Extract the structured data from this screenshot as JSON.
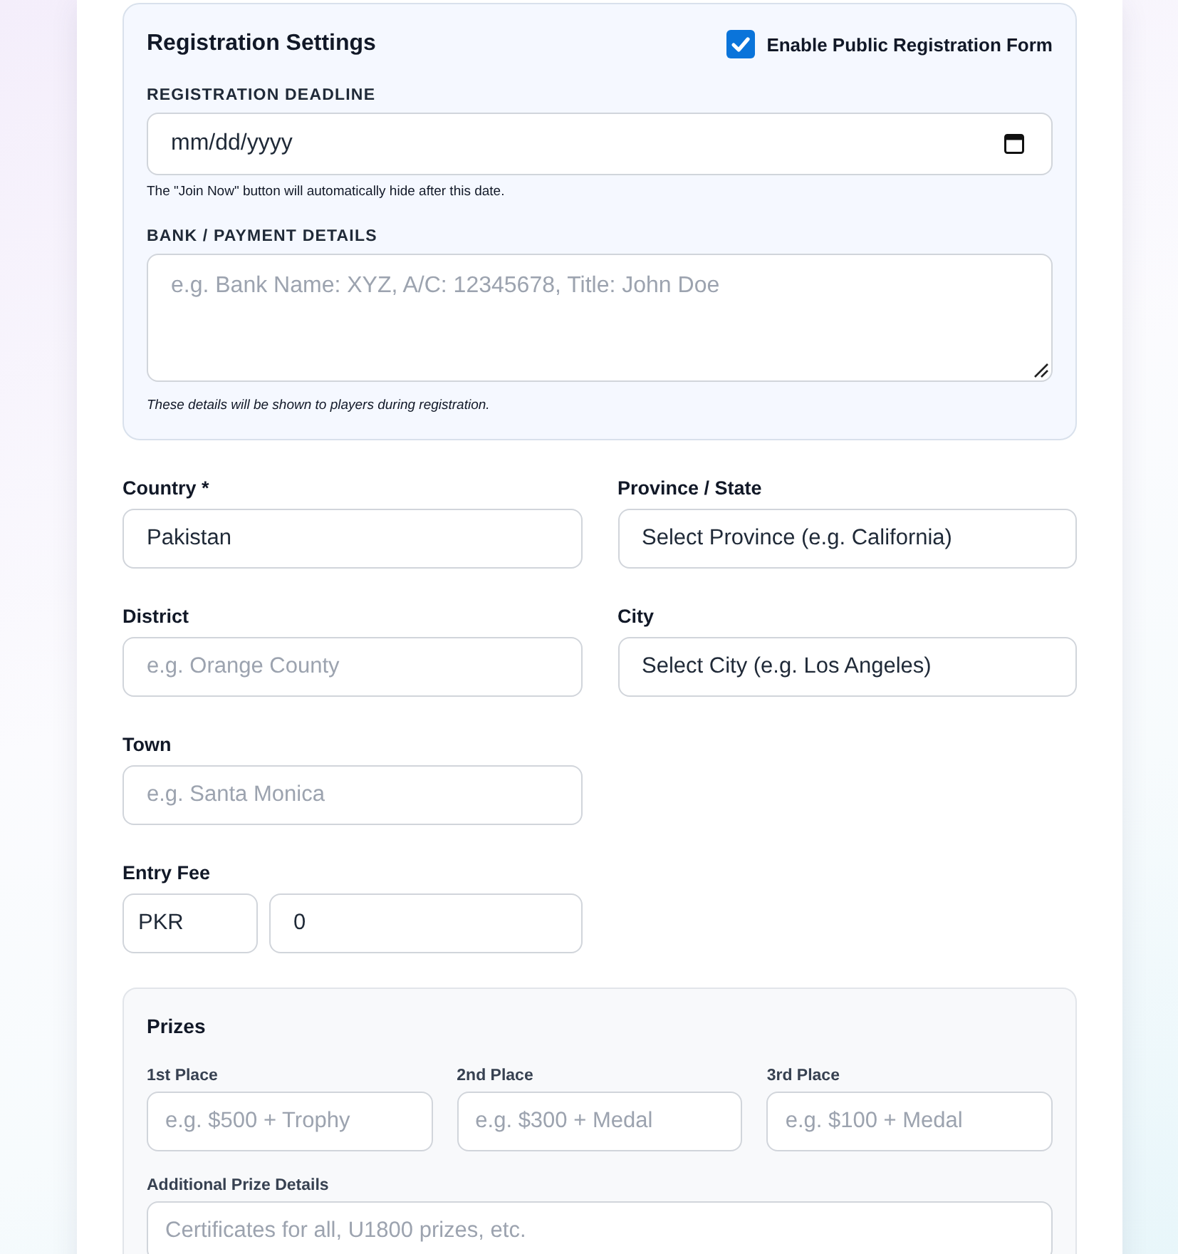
{
  "registration_settings": {
    "title": "Registration Settings",
    "enable_public_form": {
      "label": "Enable Public Registration Form",
      "checked": true
    },
    "deadline": {
      "label": "REGISTRATION DEADLINE",
      "placeholder": "mm/dd/yyyy",
      "help": "The \"Join Now\" button will automatically hide after this date."
    },
    "bank_details": {
      "label": "BANK / PAYMENT DETAILS",
      "placeholder": "e.g. Bank Name: XYZ, A/C: 12345678, Title: John Doe",
      "help": "These details will be shown to players during registration."
    }
  },
  "location_fields": [
    {
      "label": "Country *",
      "value": "Pakistan"
    },
    {
      "label": "Province / State",
      "value": "Select Province (e.g. California)"
    },
    {
      "label": "District",
      "placeholder": "e.g. Orange County"
    },
    {
      "label": "City",
      "value": "Select City (e.g. Los Angeles)"
    },
    {
      "label": "Town",
      "placeholder": "e.g. Santa Monica"
    }
  ],
  "entry_fee": {
    "label": "Entry Fee",
    "currency": "PKR",
    "amount": "0"
  },
  "prizes": {
    "title": "Prizes",
    "places": [
      {
        "label": "1st Place",
        "placeholder": "e.g. $500 + Trophy"
      },
      {
        "label": "2nd Place",
        "placeholder": "e.g. $300 + Medal"
      },
      {
        "label": "3rd Place",
        "placeholder": "e.g. $100 + Medal"
      }
    ],
    "additional": {
      "label": "Additional Prize Details",
      "placeholder": "Certificates for all, U1800 prizes, etc."
    }
  }
}
